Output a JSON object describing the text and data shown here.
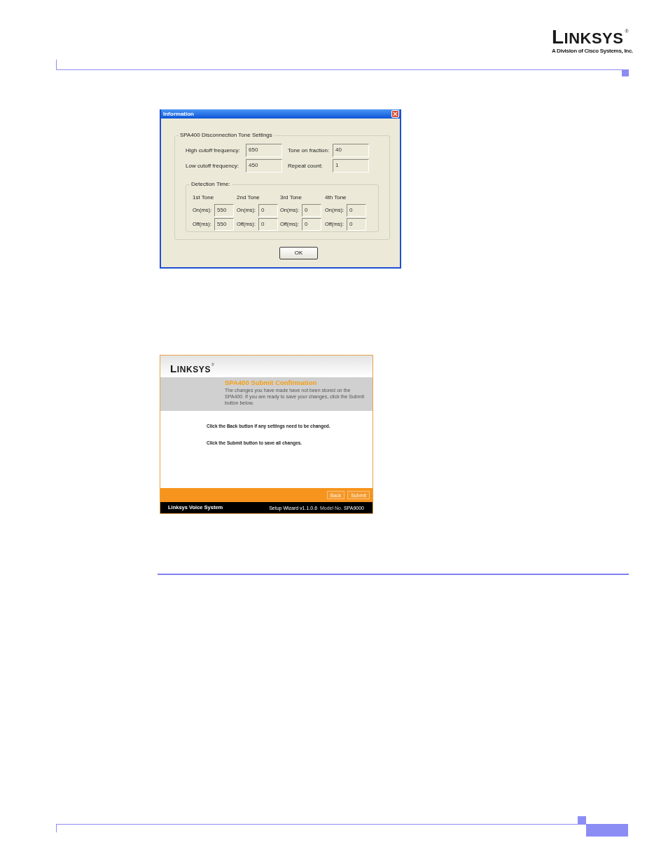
{
  "header": {
    "logo": {
      "wordmark": "LINKSYS",
      "registered": "®",
      "tagline": "A Division of Cisco Systems, Inc."
    }
  },
  "dialog": {
    "title": "Information",
    "group_title": "SPA400 Disconnection Tone Settings",
    "fields": [
      {
        "label": "High cutoff frequency:",
        "value": "650"
      },
      {
        "label": "Tone on fraction:",
        "value": "40"
      },
      {
        "label": "Low cutoff frequency:",
        "value": "450"
      },
      {
        "label": "Repeat count:",
        "value": "1"
      }
    ],
    "detection": {
      "title": "Detection Time:",
      "tones": [
        {
          "name": "1st Tone",
          "on_label": "On(ms):",
          "on_value": "550",
          "off_label": "Off(ms):",
          "off_value": "550"
        },
        {
          "name": "2nd Tone",
          "on_label": "On(ms):",
          "on_value": "0",
          "off_label": "Off(ms):",
          "off_value": "0"
        },
        {
          "name": "3rd Tone",
          "on_label": "On(ms):",
          "on_value": "0",
          "off_label": "Off(ms):",
          "off_value": "0"
        },
        {
          "name": "4th Tone",
          "on_label": "On(ms):",
          "on_value": "0",
          "off_label": "Off(ms):",
          "off_value": "0"
        }
      ]
    },
    "ok_button": "OK"
  },
  "wizard": {
    "logo": {
      "wordmark": "LINKSYS",
      "registered": "®"
    },
    "title": "SPA400 Submit Confirmation",
    "description": "The changes you have made have not been stored on the SPA400. If you are ready to save your changes, click the Submit button below.",
    "instructions": [
      "Click the Back button if any settings need to be changed.",
      "Click the Submit button to save all changes."
    ],
    "buttons": [
      "Back",
      "Submit"
    ],
    "footer": {
      "brand": "Linksys Voice System",
      "version": "Setup Wizard v1.1.0.6",
      "model_label": "Model No.",
      "model": "SPA9000"
    }
  }
}
